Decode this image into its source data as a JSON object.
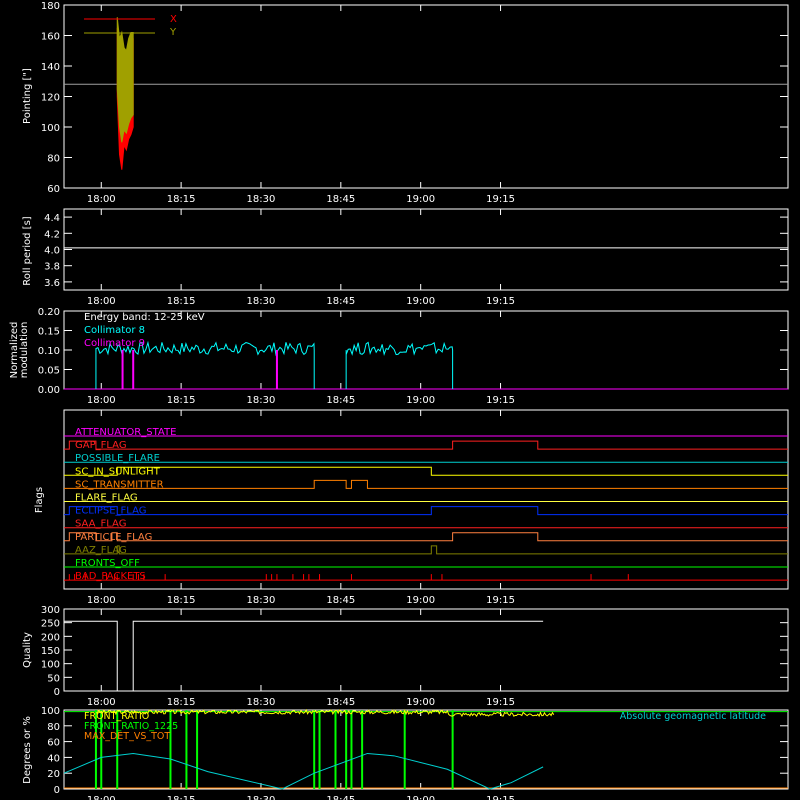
{
  "time_ticks": [
    "18:00",
    "18:15",
    "18:30",
    "18:45",
    "19:00",
    "19:15"
  ],
  "time_range_min": [
    1073,
    1209
  ],
  "time_tick_values_min": [
    1080,
    1095,
    1110,
    1125,
    1140,
    1155
  ],
  "chart_data": [
    {
      "type": "line",
      "panel": "pointing",
      "ylabel": "Pointing [\"]",
      "ylim": [
        60,
        180
      ],
      "yticks": [
        60,
        80,
        100,
        120,
        140,
        160,
        180
      ],
      "legend": [
        {
          "name": "X",
          "color": "#ff0000"
        },
        {
          "name": "Y",
          "color": "#a0a000"
        }
      ],
      "series": [
        {
          "name": "X",
          "color": "#ff0000",
          "x_start": "18:03",
          "x_end": "18:06",
          "band_low": [
            120,
            82,
            72,
            88,
            85,
            92,
            95,
            100
          ],
          "band_high": [
            165,
            150,
            155,
            150,
            148,
            155,
            160,
            158
          ]
        },
        {
          "name": "Y",
          "color": "#a0a000",
          "x_start": "18:03",
          "x_end": "18:06",
          "band_low": [
            125,
            100,
            90,
            98,
            96,
            102,
            106,
            108
          ],
          "band_high": [
            172,
            158,
            162,
            152,
            150,
            158,
            162,
            162
          ]
        }
      ],
      "reference_line": {
        "y": 128,
        "color": "#a0a0a0"
      }
    },
    {
      "type": "line",
      "panel": "roll",
      "ylabel": "Roll period [s]",
      "ylim": [
        3.5,
        4.5
      ],
      "yticks": [
        "3.6",
        "3.8",
        "4.0",
        "4.2",
        "4.4"
      ],
      "series": [
        {
          "name": "",
          "color": "#ffffff",
          "y": 4.02
        }
      ]
    },
    {
      "type": "line",
      "panel": "modulation",
      "ylabel": "Normalized modulation",
      "ylim": [
        0,
        0.2
      ],
      "yticks": [
        "0.00",
        "0.05",
        "0.10",
        "0.15",
        "0.20"
      ],
      "annotation": "Energy band: 12-25 keV",
      "legend": [
        {
          "name": "Collimator 8",
          "color": "#00ffff"
        },
        {
          "name": "Collimator 9",
          "color": "#ff00ff"
        }
      ],
      "series": [
        {
          "name": "Collimator 8",
          "color": "#00ffff",
          "segments": [
            {
              "start": "17:59",
              "end": "18:40",
              "level": 0.1
            },
            {
              "start": "18:46",
              "end": "19:06",
              "level": 0.1
            }
          ]
        },
        {
          "name": "Collimator 9",
          "color": "#ff00ff",
          "spikes": [
            "18:04",
            "18:06",
            "18:33"
          ],
          "spike_level": 0.1
        }
      ]
    },
    {
      "type": "line",
      "panel": "flags",
      "ylabel": "Flags",
      "flags": [
        {
          "name": "ATTENUATOR_STATE",
          "color": "#ff00ff",
          "high": []
        },
        {
          "name": "GAP_FLAG",
          "color": "#ff2020",
          "high": [
            [
              "17:54",
              "17:59"
            ],
            [
              "19:06",
              "19:22"
            ]
          ]
        },
        {
          "name": "POSSIBLE_FLARE",
          "color": "#00d0d0",
          "high": []
        },
        {
          "name": "SC_IN_SUNLIGHT",
          "color": "#ffff00",
          "high": [
            [
              "18:03",
              "19:02"
            ]
          ]
        },
        {
          "name": "SC_TRANSMITTER",
          "color": "#ff8000",
          "high": [
            [
              "18:40",
              "18:46"
            ],
            [
              "18:47",
              "18:50"
            ]
          ]
        },
        {
          "name": "FLARE_FLAG",
          "color": "#ffff40",
          "high": []
        },
        {
          "name": "ECLIPSE_FLAG",
          "color": "#0030ff",
          "high": [
            [
              "17:54",
              "18:03"
            ],
            [
              "19:02",
              "19:22"
            ]
          ]
        },
        {
          "name": "SAA_FLAG",
          "color": "#ff2020",
          "high": []
        },
        {
          "name": "PARTICLE_FLAG",
          "color": "#ff8040",
          "high": [
            [
              "17:54",
              "17:59"
            ],
            [
              "18:02",
              "18:03"
            ],
            [
              "19:06",
              "19:22"
            ]
          ]
        },
        {
          "name": "AAZ_FLAG",
          "color": "#808000",
          "high": [
            [
              "18:03",
              "18:03"
            ],
            [
              "19:02",
              "19:03"
            ]
          ]
        },
        {
          "name": "FRONTS_OFF",
          "color": "#00ff00",
          "high": []
        },
        {
          "name": "BAD_PACKETS",
          "color": "#ff0000",
          "high": []
        }
      ]
    },
    {
      "type": "line",
      "panel": "quality",
      "ylabel": "Quality",
      "ylim": [
        0,
        300
      ],
      "yticks": [
        0,
        50,
        100,
        150,
        200,
        250,
        300
      ],
      "series": [
        {
          "name": "",
          "color": "#ffffff",
          "points": [
            [
              "17:53",
              255
            ],
            [
              "18:03",
              255
            ],
            [
              "18:03",
              0
            ],
            [
              "18:06",
              0
            ],
            [
              "18:06",
              255
            ],
            [
              "19:23",
              255
            ]
          ]
        }
      ]
    },
    {
      "type": "line",
      "panel": "latitude",
      "ylabel": "Degrees or %",
      "ylim": [
        0,
        100
      ],
      "yticks": [
        0,
        20,
        40,
        60,
        80,
        100
      ],
      "legend": [
        {
          "name": "FRONT_RATIO",
          "color": "#ffff00"
        },
        {
          "name": "FRONT_RATIO_1225",
          "color": "#00ff00"
        },
        {
          "name": "MAX_DET_VS_TOT",
          "color": "#ff8000"
        }
      ],
      "annotation": "Absolute geomagnetic latitude",
      "series": [
        {
          "name": "FRONT_RATIO",
          "color": "#ffff00",
          "y": 97
        },
        {
          "name": "FRONT_RATIO_1225",
          "color": "#00ff00",
          "drops": [
            "17:59",
            "18:00",
            "18:03",
            "18:13",
            "18:16",
            "18:18",
            "18:40",
            "18:41",
            "18:44",
            "18:46",
            "18:47",
            "18:49",
            "18:57",
            "19:06"
          ]
        },
        {
          "name": "MAX_DET_VS_TOT",
          "color": "#ff8000",
          "y": 0
        },
        {
          "name": "Absolute geomagnetic latitude",
          "color": "#00d0d0",
          "points": [
            [
              "17:53",
              20
            ],
            [
              "18:00",
              40
            ],
            [
              "18:06",
              45
            ],
            [
              "18:13",
              38
            ],
            [
              "18:20",
              22
            ],
            [
              "18:34",
              0
            ],
            [
              "18:40",
              20
            ],
            [
              "18:50",
              45
            ],
            [
              "18:55",
              42
            ],
            [
              "19:05",
              25
            ],
            [
              "19:13",
              0
            ],
            [
              "19:17",
              8
            ],
            [
              "19:23",
              28
            ]
          ]
        }
      ]
    }
  ]
}
